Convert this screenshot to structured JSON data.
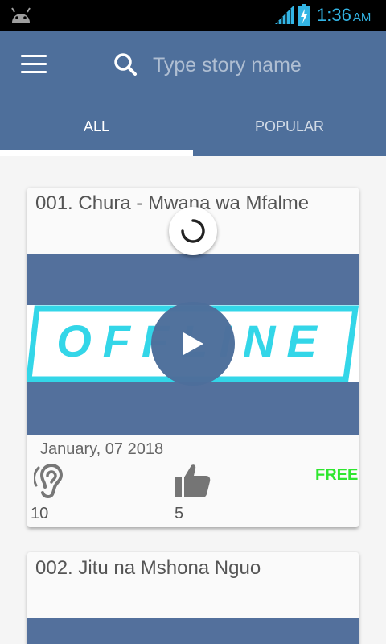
{
  "status_bar": {
    "time": "1:36",
    "ampm": "AM"
  },
  "search": {
    "placeholder": "Type story name"
  },
  "tabs": [
    {
      "label": "ALL",
      "selected": true
    },
    {
      "label": "POPULAR",
      "selected": false
    }
  ],
  "stories": [
    {
      "title": "001. Chura - Mwana wa Mfalme",
      "thumbnail_text": "OFFLINE",
      "date": "January, 07 2018",
      "listens": "10",
      "likes": "5",
      "price": "FREE"
    },
    {
      "title": "002. Jitu na Mshona Nguo"
    }
  ],
  "colors": {
    "app_bar": "#4e6f9b",
    "accent_cyan": "#33d6e8",
    "free_green": "#2ee62e",
    "status_icons": "#33b5e5"
  },
  "icons": [
    "android-icon",
    "signal-icon",
    "battery-charging-icon",
    "menu-icon",
    "search-icon",
    "loading-spinner-icon",
    "play-icon",
    "ear-listen-icon",
    "thumbs-up-icon"
  ]
}
